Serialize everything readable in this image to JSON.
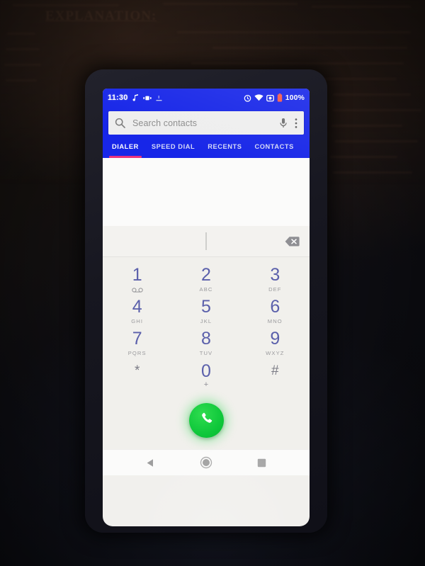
{
  "background": {
    "document_heading": "EXPLANATION:"
  },
  "statusbar": {
    "time": "11:30",
    "battery_percent": "100%",
    "left_icons": [
      "music-note-icon",
      "vibrate-icon",
      "download-icon"
    ],
    "right_icons": [
      "alarm-icon",
      "wifi-icon",
      "screenshot-icon",
      "battery-icon"
    ]
  },
  "search": {
    "placeholder": "Search contacts",
    "icons": [
      "search-icon",
      "microphone-icon",
      "overflow-menu-icon"
    ]
  },
  "tabs": [
    {
      "label": "DIALER",
      "active": true
    },
    {
      "label": "SPEED DIAL",
      "active": false
    },
    {
      "label": "RECENTS",
      "active": false
    },
    {
      "label": "CONTACTS",
      "active": false
    }
  ],
  "digit_field": {
    "value": "",
    "backspace_label": "backspace"
  },
  "dialpad": {
    "keys": [
      {
        "digit": "1",
        "sub": "",
        "icon": "voicemail-icon"
      },
      {
        "digit": "2",
        "sub": "ABC",
        "icon": ""
      },
      {
        "digit": "3",
        "sub": "DEF",
        "icon": ""
      },
      {
        "digit": "4",
        "sub": "GHI",
        "icon": ""
      },
      {
        "digit": "5",
        "sub": "JKL",
        "icon": ""
      },
      {
        "digit": "6",
        "sub": "MNO",
        "icon": ""
      },
      {
        "digit": "7",
        "sub": "PQRS",
        "icon": ""
      },
      {
        "digit": "8",
        "sub": "TUV",
        "icon": ""
      },
      {
        "digit": "9",
        "sub": "WXYZ",
        "icon": ""
      },
      {
        "digit": "*",
        "sub": "",
        "icon": ""
      },
      {
        "digit": "0",
        "sub": "+",
        "icon": ""
      },
      {
        "digit": "#",
        "sub": "",
        "icon": ""
      }
    ]
  },
  "call_button": {
    "label": "Call",
    "icon": "phone-icon",
    "color": "#0ec73a"
  },
  "navbar": {
    "back": "back-icon",
    "home": "home-icon",
    "recents": "recents-icon"
  },
  "colors": {
    "accent_blue": "#1726e8",
    "tab_underline": "#e8337f",
    "digit_blue": "#5b60ab",
    "call_green": "#0ec73a"
  }
}
